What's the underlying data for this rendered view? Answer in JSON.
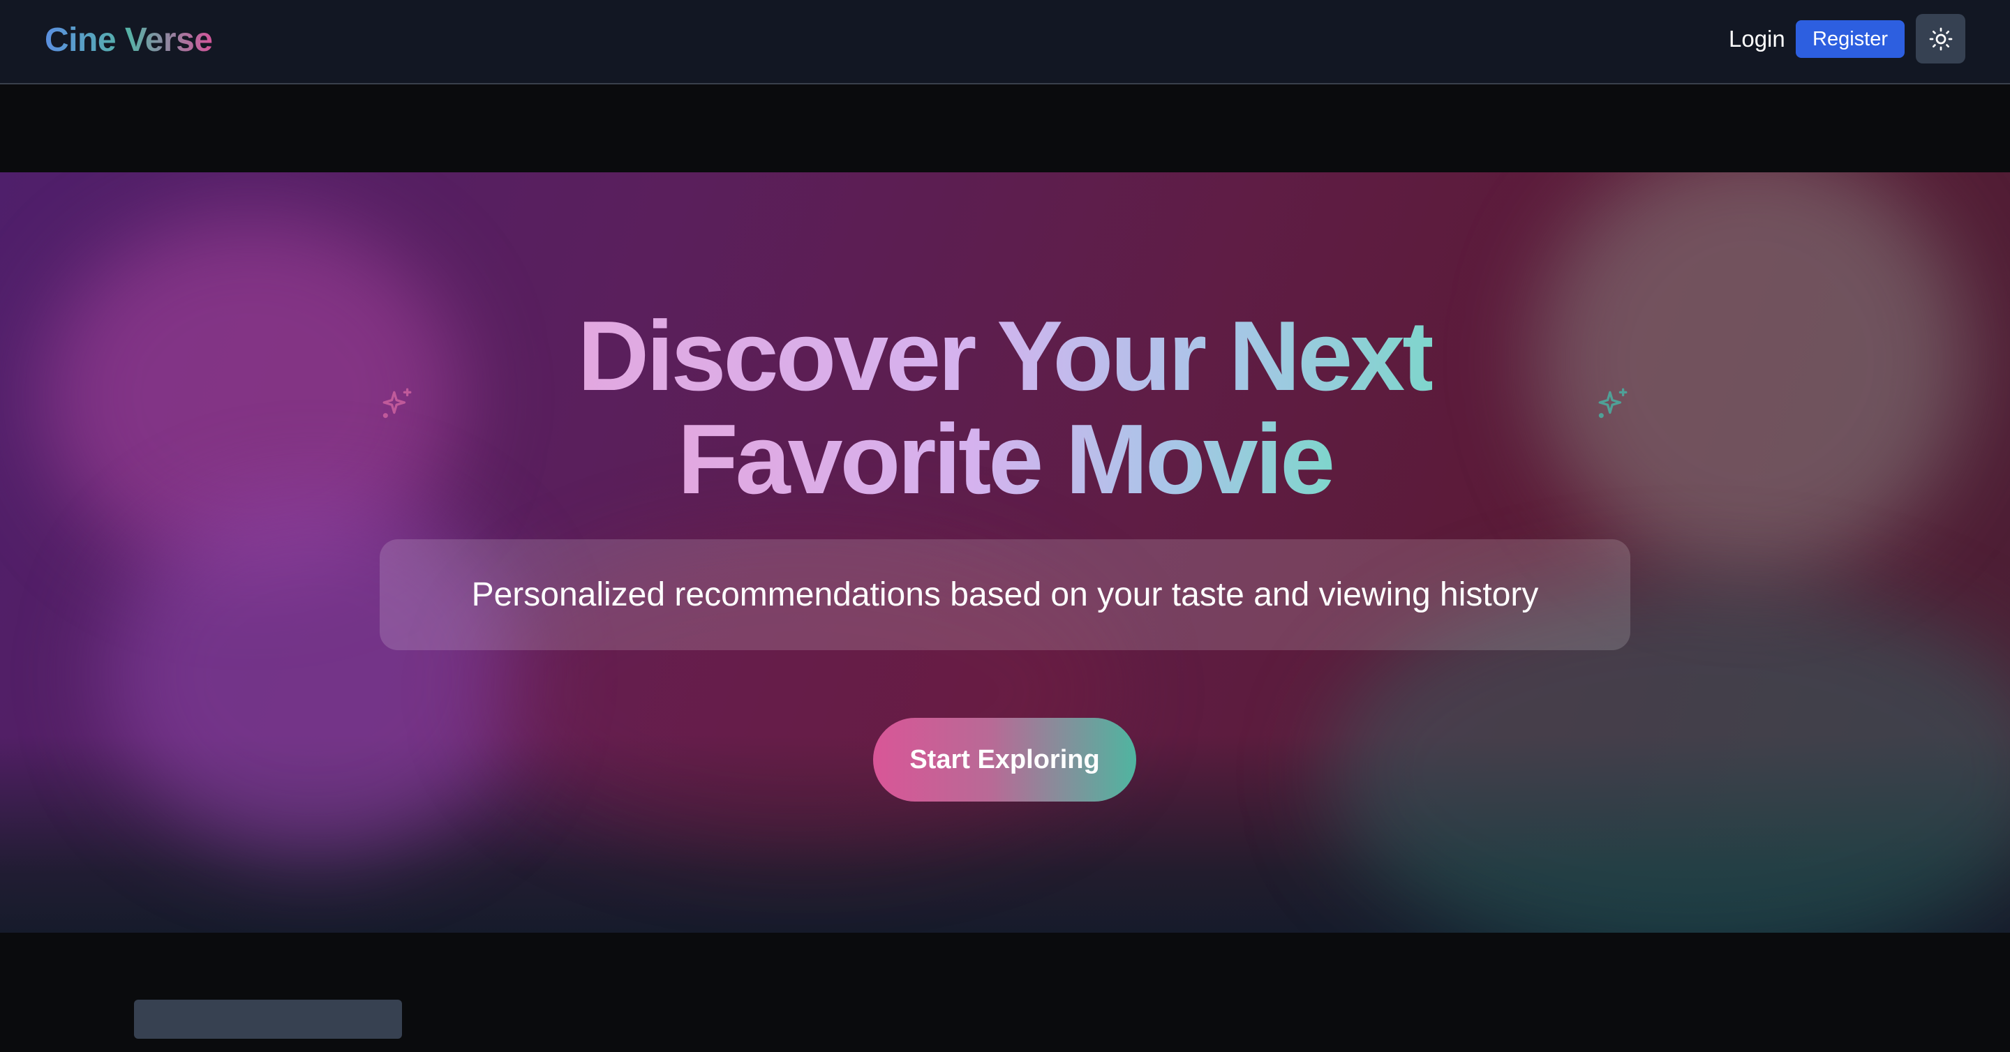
{
  "navbar": {
    "logo": "Cine Verse",
    "login_label": "Login",
    "register_label": "Register",
    "theme_toggle_icon": "sun-icon"
  },
  "hero": {
    "headline_line1": "Discover Your Next",
    "headline_line2": "Favorite Movie",
    "subtitle": "Personalized recommendations based on your taste and viewing history",
    "cta_label": "Start Exploring",
    "decor_icons": [
      "sparkles-icon",
      "sparkles-icon"
    ]
  },
  "colors": {
    "navbar_bg": "#121723",
    "register_bg": "#2d5fe0",
    "theme_toggle_bg": "#364152",
    "cta_gradient_start": "#d95697",
    "cta_gradient_end": "#4fb5a0",
    "page_bg": "#0a0b0d"
  }
}
